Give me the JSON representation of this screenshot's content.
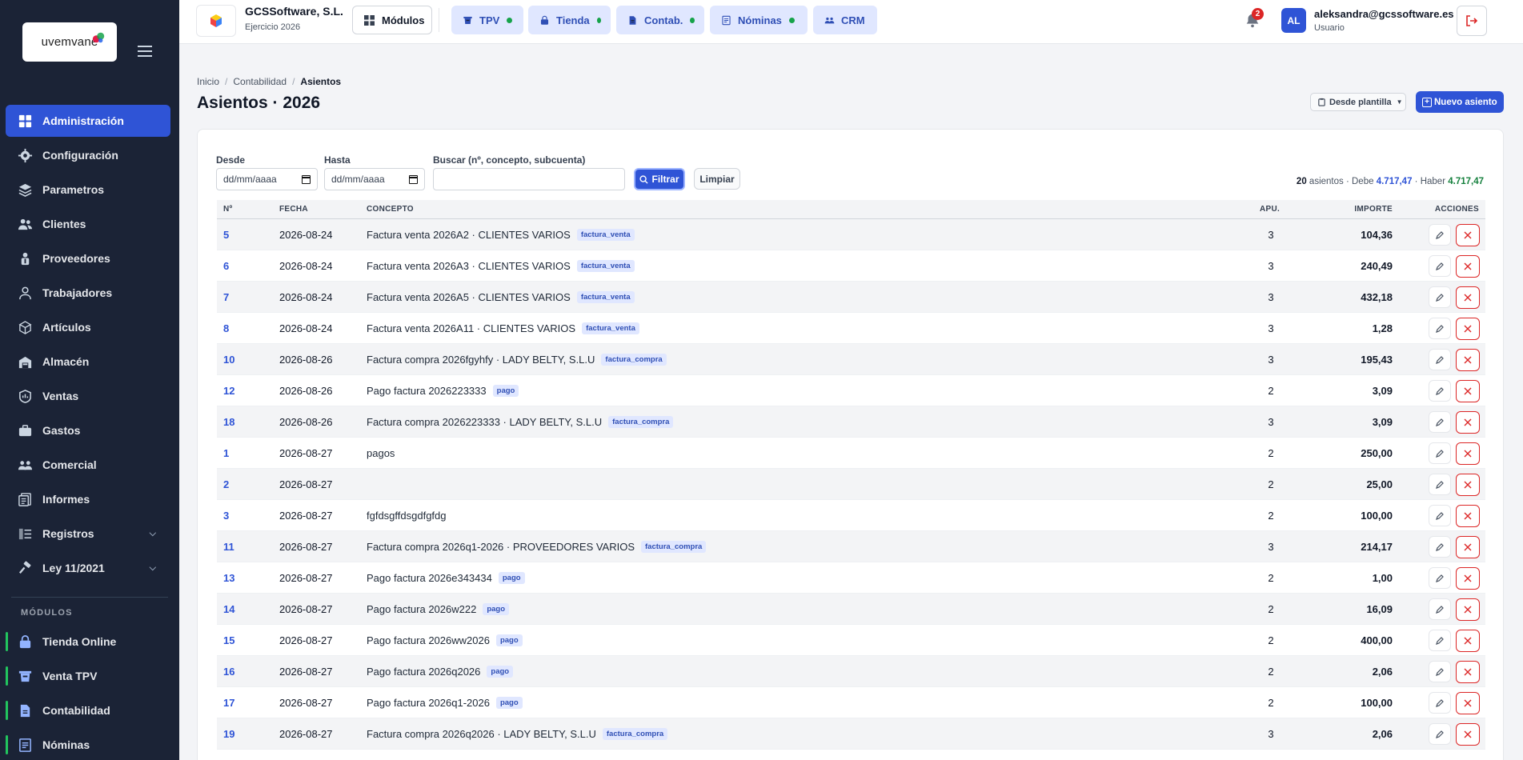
{
  "brand": {
    "logo_text": "uvemvane"
  },
  "sidebar": {
    "items": [
      {
        "key": "administracion",
        "label": "Administración",
        "icon": "dashboard-icon",
        "active": true
      },
      {
        "key": "configuracion",
        "label": "Configuración",
        "icon": "gear-icon"
      },
      {
        "key": "parametros",
        "label": "Parametros",
        "icon": "layers-icon"
      },
      {
        "key": "clientes",
        "label": "Clientes",
        "icon": "users-icon"
      },
      {
        "key": "proveedores",
        "label": "Proveedores",
        "icon": "supplier-icon"
      },
      {
        "key": "trabajadores",
        "label": "Trabajadores",
        "icon": "user-icon"
      },
      {
        "key": "articulos",
        "label": "Artículos",
        "icon": "box-icon"
      },
      {
        "key": "almacen",
        "label": "Almacén",
        "icon": "warehouse-icon"
      },
      {
        "key": "ventas",
        "label": "Ventas",
        "icon": "sales-icon"
      },
      {
        "key": "gastos",
        "label": "Gastos",
        "icon": "briefcase-icon"
      },
      {
        "key": "comercial",
        "label": "Comercial",
        "icon": "team-icon"
      },
      {
        "key": "informes",
        "label": "Informes",
        "icon": "report-icon"
      },
      {
        "key": "registros",
        "label": "Registros",
        "icon": "list-icon",
        "expandable": true
      },
      {
        "key": "ley",
        "label": "Ley 11/2021",
        "icon": "gavel-icon",
        "expandable": true
      }
    ],
    "modules_title": "MÓDULOS",
    "modules": [
      {
        "key": "tienda",
        "label": "Tienda Online",
        "icon": "lock-bag-icon"
      },
      {
        "key": "tpv",
        "label": "Venta TPV",
        "icon": "register-icon"
      },
      {
        "key": "contabilidad",
        "label": "Contabilidad",
        "icon": "document-icon"
      },
      {
        "key": "nominas",
        "label": "Nóminas",
        "icon": "payroll-icon"
      }
    ]
  },
  "topbar": {
    "company_name": "GCSSoftware, S.L.",
    "company_year": "Ejercicio 2026",
    "modules_label": "Módulos",
    "tabs": [
      {
        "key": "tpv",
        "label": "TPV",
        "icon": "register-icon"
      },
      {
        "key": "tienda",
        "label": "Tienda",
        "icon": "lock-bag-icon"
      },
      {
        "key": "contab",
        "label": "Contab.",
        "icon": "document-icon"
      },
      {
        "key": "nominas",
        "label": "Nóminas",
        "icon": "payroll-icon"
      },
      {
        "key": "crm",
        "label": "CRM",
        "icon": "team-icon"
      }
    ],
    "notifications_count": "2",
    "user_initials": "AL",
    "user_email": "aleksandra@gcssoftware.es",
    "user_role": "Usuario"
  },
  "breadcrumb": {
    "home": "Inicio",
    "section": "Contabilidad",
    "current": "Asientos"
  },
  "page_title": "Asientos · 2026",
  "actions": {
    "template_label": "Desde plantilla",
    "new_label": "Nuevo asiento"
  },
  "filters": {
    "desde_label": "Desde",
    "desde_value": "dd/mm/aaaa",
    "hasta_label": "Hasta",
    "hasta_value": "dd/mm/aaaa",
    "search_label": "Buscar (nº, concepto, subcuenta)",
    "search_value": "",
    "filter_button": "Filtrar",
    "clear_button": "Limpiar"
  },
  "summary": {
    "count": "20",
    "count_label": "asientos",
    "debe_label": "Debe",
    "debe_value": "4.717,47",
    "haber_label": "Haber",
    "haber_value": "4.717,47"
  },
  "table": {
    "headers": {
      "n": "Nº",
      "fecha": "FECHA",
      "concepto": "CONCEPTO",
      "apu": "APU.",
      "importe": "IMPORTE",
      "acciones": "ACCIONES"
    },
    "rows": [
      {
        "n": "5",
        "fecha": "2026-08-24",
        "concepto": "Factura venta 2026A2 · CLIENTES VARIOS",
        "tag": "factura_venta",
        "apu": "3",
        "importe": "104,36"
      },
      {
        "n": "6",
        "fecha": "2026-08-24",
        "concepto": "Factura venta 2026A3 · CLIENTES VARIOS",
        "tag": "factura_venta",
        "apu": "3",
        "importe": "240,49"
      },
      {
        "n": "7",
        "fecha": "2026-08-24",
        "concepto": "Factura venta 2026A5 · CLIENTES VARIOS",
        "tag": "factura_venta",
        "apu": "3",
        "importe": "432,18"
      },
      {
        "n": "8",
        "fecha": "2026-08-24",
        "concepto": "Factura venta 2026A11 · CLIENTES VARIOS",
        "tag": "factura_venta",
        "apu": "3",
        "importe": "1,28"
      },
      {
        "n": "10",
        "fecha": "2026-08-26",
        "concepto": "Factura compra 2026fgyhfy · LADY BELTY, S.L.U",
        "tag": "factura_compra",
        "apu": "3",
        "importe": "195,43"
      },
      {
        "n": "12",
        "fecha": "2026-08-26",
        "concepto": "Pago factura 2026223333",
        "tag": "pago",
        "apu": "2",
        "importe": "3,09"
      },
      {
        "n": "18",
        "fecha": "2026-08-26",
        "concepto": "Factura compra 2026223333 · LADY BELTY, S.L.U",
        "tag": "factura_compra",
        "apu": "3",
        "importe": "3,09"
      },
      {
        "n": "1",
        "fecha": "2026-08-27",
        "concepto": "pagos",
        "tag": "",
        "apu": "2",
        "importe": "250,00"
      },
      {
        "n": "2",
        "fecha": "2026-08-27",
        "concepto": "",
        "tag": "",
        "apu": "2",
        "importe": "25,00"
      },
      {
        "n": "3",
        "fecha": "2026-08-27",
        "concepto": "fgfdsgffdsgdfgfdg",
        "tag": "",
        "apu": "2",
        "importe": "100,00"
      },
      {
        "n": "11",
        "fecha": "2026-08-27",
        "concepto": "Factura compra 2026q1-2026 · PROVEEDORES VARIOS",
        "tag": "factura_compra",
        "apu": "3",
        "importe": "214,17"
      },
      {
        "n": "13",
        "fecha": "2026-08-27",
        "concepto": "Pago factura 2026e343434",
        "tag": "pago",
        "apu": "2",
        "importe": "1,00"
      },
      {
        "n": "14",
        "fecha": "2026-08-27",
        "concepto": "Pago factura 2026w222",
        "tag": "pago",
        "apu": "2",
        "importe": "16,09"
      },
      {
        "n": "15",
        "fecha": "2026-08-27",
        "concepto": "Pago factura 2026ww2026",
        "tag": "pago",
        "apu": "2",
        "importe": "400,00"
      },
      {
        "n": "16",
        "fecha": "2026-08-27",
        "concepto": "Pago factura 2026q2026",
        "tag": "pago",
        "apu": "2",
        "importe": "2,06"
      },
      {
        "n": "17",
        "fecha": "2026-08-27",
        "concepto": "Pago factura 2026q1-2026",
        "tag": "pago",
        "apu": "2",
        "importe": "100,00"
      },
      {
        "n": "19",
        "fecha": "2026-08-27",
        "concepto": "Factura compra 2026q2026 · LADY BELTY, S.L.U",
        "tag": "factura_compra",
        "apu": "3",
        "importe": "2,06"
      }
    ]
  },
  "colors": {
    "sidebar_bg": "#1b2336",
    "accent": "#2f54d6",
    "danger": "#dc2626",
    "success": "#16a34a"
  }
}
